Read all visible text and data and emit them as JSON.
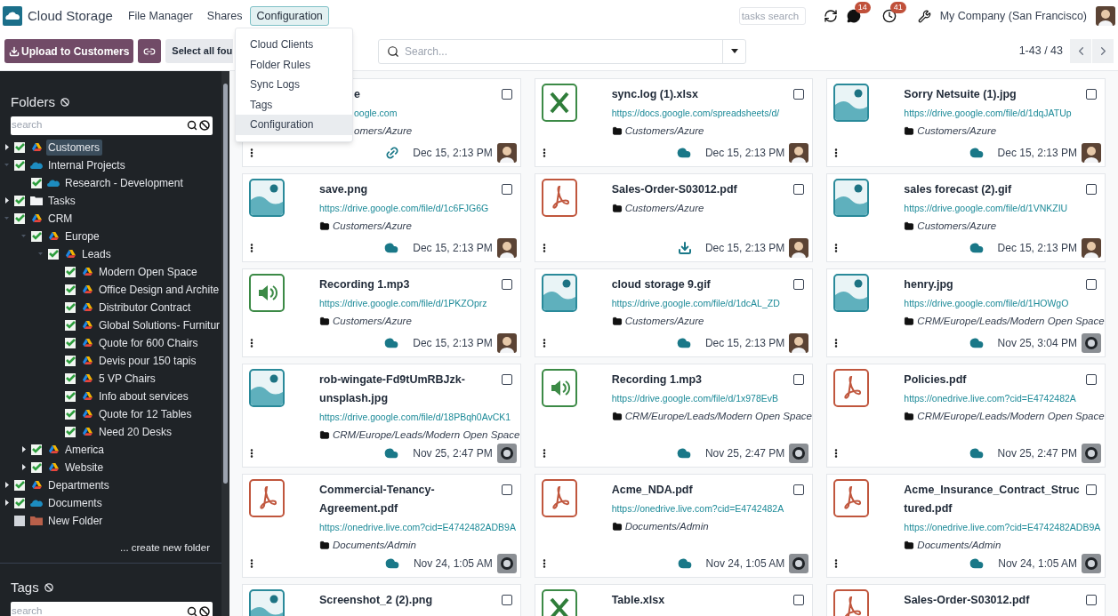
{
  "app": {
    "name": "Cloud Storage"
  },
  "nav": [
    {
      "label": "File Manager",
      "selected": false
    },
    {
      "label": "Shares",
      "selected": false
    },
    {
      "label": "Configuration",
      "selected": true
    }
  ],
  "menu": [
    {
      "label": "Cloud Clients",
      "selected": false
    },
    {
      "label": "Folder Rules",
      "selected": false
    },
    {
      "label": "Sync Logs",
      "selected": false
    },
    {
      "label": "Tags",
      "selected": false
    },
    {
      "label": "Configuration",
      "selected": true
    }
  ],
  "systray": {
    "tasks_search": {
      "placeholder": "tasks search"
    },
    "messages_badge": "14",
    "activities_badge": "41",
    "company": "My Company (San Francisco)"
  },
  "toolbar": {
    "upload_button": "Upload to Customers",
    "select_all_button": "Select all fou",
    "search": {
      "placeholder": "Search..."
    },
    "pager": "1-43 / 43"
  },
  "folders": {
    "title": "Folders",
    "search": {
      "placeholder": "search"
    },
    "create_link": "... create new folder",
    "tree": [
      {
        "label": "Customers",
        "kind": "drive",
        "checked": true,
        "selected": true,
        "expanded": false
      },
      {
        "label": "Internal Projects",
        "kind": "cloud",
        "checked": true,
        "selected": false,
        "expanded": true,
        "children": [
          {
            "label": "Research - Development",
            "kind": "cloud",
            "checked": true,
            "selected": false
          }
        ]
      },
      {
        "label": "Tasks",
        "kind": "folder",
        "checked": true,
        "selected": false,
        "expanded": false
      },
      {
        "label": "CRM",
        "kind": "drive",
        "checked": true,
        "selected": false,
        "expanded": true,
        "children": [
          {
            "label": "Europe",
            "kind": "drive",
            "checked": true,
            "selected": false,
            "expanded": true,
            "children": [
              {
                "label": "Leads",
                "kind": "drive",
                "checked": true,
                "selected": false,
                "expanded": true,
                "children": [
                  {
                    "label": "Modern Open Space",
                    "kind": "drive",
                    "checked": true,
                    "selected": false
                  },
                  {
                    "label": "Office Design and Archite",
                    "kind": "drive",
                    "checked": true,
                    "selected": false
                  },
                  {
                    "label": "Distributor Contract",
                    "kind": "drive",
                    "checked": true,
                    "selected": false
                  },
                  {
                    "label": "Global Solutions- Furnitur",
                    "kind": "drive",
                    "checked": true,
                    "selected": false
                  },
                  {
                    "label": "Quote for 600 Chairs",
                    "kind": "drive",
                    "checked": true,
                    "selected": false
                  },
                  {
                    "label": "Devis pour 150 tapis",
                    "kind": "drive",
                    "checked": true,
                    "selected": false
                  },
                  {
                    "label": "5 VP Chairs",
                    "kind": "drive",
                    "checked": true,
                    "selected": false
                  },
                  {
                    "label": "Info about services",
                    "kind": "drive",
                    "checked": true,
                    "selected": false
                  },
                  {
                    "label": "Quote for 12 Tables",
                    "kind": "drive",
                    "checked": true,
                    "selected": false
                  },
                  {
                    "label": "Need 20 Desks",
                    "kind": "drive",
                    "checked": true,
                    "selected": false
                  }
                ]
              }
            ]
          },
          {
            "label": "America",
            "kind": "drive",
            "checked": true,
            "selected": false,
            "expanded": false
          },
          {
            "label": "Website",
            "kind": "drive",
            "checked": true,
            "selected": false,
            "expanded": false
          }
        ]
      },
      {
        "label": "Departments",
        "kind": "drive",
        "checked": true,
        "selected": false,
        "expanded": false
      },
      {
        "label": "Documents",
        "kind": "cloud",
        "checked": true,
        "selected": false,
        "expanded": false
      },
      {
        "label": "New Folder",
        "kind": "local",
        "checked": false,
        "selected": false
      }
    ]
  },
  "tags": {
    "title": "Tags",
    "search": {
      "placeholder": "search"
    }
  },
  "files": [
    {
      "title": "e",
      "url": "oogle.com",
      "folder": "omers/Azure",
      "covered": true,
      "sync": {
        "kind": "link"
      },
      "date": "Dec 15, 2:13 PM",
      "owner": {
        "kind": "person"
      },
      "checked": false
    },
    {
      "title": "sync.log (1).xlsx",
      "url": "https://docs.google.com/spreadsheets/d/",
      "folder": "Customers/Azure",
      "thumbnail": {
        "kind": "xlsx"
      },
      "sync": {
        "kind": "cloud"
      },
      "date": "Dec 15, 2:13 PM",
      "owner": {
        "kind": "person"
      },
      "checked": false
    },
    {
      "title": "Sorry Netsuite (1).jpg",
      "url": "https://drive.google.com/file/d/1dqJATUp",
      "folder": "Customers/Azure",
      "thumbnail": {
        "kind": "image"
      },
      "sync": {
        "kind": "cloud"
      },
      "date": "Dec 15, 2:13 PM",
      "owner": {
        "kind": "person"
      },
      "checked": false
    },
    {
      "title": "save.png",
      "url": "https://drive.google.com/file/d/1c6FJG6G",
      "folder": "Customers/Azure",
      "thumbnail": {
        "kind": "image"
      },
      "sync": {
        "kind": "cloud"
      },
      "date": "Dec 15, 2:13 PM",
      "owner": {
        "kind": "person"
      },
      "checked": false
    },
    {
      "title": "Sales-Order-S03012.pdf",
      "folder": "Customers/Azure",
      "thumbnail": {
        "kind": "pdf"
      },
      "sync": {
        "kind": "download"
      },
      "date": "Dec 15, 2:13 PM",
      "owner": {
        "kind": "person"
      },
      "checked": false
    },
    {
      "title": "sales forecast (2).gif",
      "url": "https://drive.google.com/file/d/1VNKZIU",
      "folder": "Customers/Azure",
      "thumbnail": {
        "kind": "image"
      },
      "sync": {
        "kind": "cloud"
      },
      "date": "Dec 15, 2:13 PM",
      "owner": {
        "kind": "person"
      },
      "checked": false
    },
    {
      "title": "Recording 1.mp3",
      "url": "https://drive.google.com/file/d/1PKZOprz",
      "folder": "Customers/Azure",
      "thumbnail": {
        "kind": "audio"
      },
      "sync": {
        "kind": "cloud"
      },
      "date": "Dec 15, 2:13 PM",
      "owner": {
        "kind": "person"
      },
      "checked": false
    },
    {
      "title": "cloud storage 9.gif",
      "url": "https://drive.google.com/file/d/1dcAL_ZD",
      "folder": "Customers/Azure",
      "thumbnail": {
        "kind": "image"
      },
      "sync": {
        "kind": "cloud"
      },
      "date": "Dec 15, 2:13 PM",
      "owner": {
        "kind": "person"
      },
      "checked": false
    },
    {
      "title": "henry.jpg",
      "url": "https://drive.google.com/file/d/1HOWgO",
      "folder": "CRM/Europe/Leads/Modern Open Space",
      "thumbnail": {
        "kind": "image"
      },
      "sync": {
        "kind": "cloud"
      },
      "date": "Nov 25, 3:04 PM",
      "owner": {
        "kind": "bot"
      },
      "checked": false
    },
    {
      "title": "rob-wingate-Fd9tUmRBJzk-unsplash.jpg",
      "url": "https://drive.google.com/file/d/18PBqh0AvCK1",
      "folder": "CRM/Europe/Leads/Modern Open Space",
      "thumbnail": {
        "kind": "image"
      },
      "sync": {
        "kind": "cloud"
      },
      "date": "Nov 25, 2:47 PM",
      "owner": {
        "kind": "bot"
      },
      "checked": false
    },
    {
      "title": "Recording 1.mp3",
      "url": "https://drive.google.com/file/d/1x978EvB",
      "folder": "CRM/Europe/Leads/Modern Open Space",
      "thumbnail": {
        "kind": "audio"
      },
      "sync": {
        "kind": "cloud"
      },
      "date": "Nov 25, 2:47 PM",
      "owner": {
        "kind": "bot"
      },
      "checked": false
    },
    {
      "title": "Policies.pdf",
      "url": "https://onedrive.live.com?cid=E4742482A",
      "folder": "CRM/Europe/Leads/Modern Open Space",
      "thumbnail": {
        "kind": "pdf"
      },
      "sync": {
        "kind": "cloud"
      },
      "date": "Nov 25, 2:47 PM",
      "owner": {
        "kind": "bot"
      },
      "checked": false
    },
    {
      "title": "Commercial-Tenancy-Agreement.pdf",
      "url": "https://onedrive.live.com?cid=E4742482ADB9A",
      "folder": "Documents/Admin",
      "thumbnail": {
        "kind": "pdf"
      },
      "sync": {
        "kind": "cloud"
      },
      "date": "Nov 24, 1:05 AM",
      "owner": {
        "kind": "bot"
      },
      "checked": false
    },
    {
      "title": "Acme_NDA.pdf",
      "url": "https://onedrive.live.com?cid=E4742482A",
      "folder": "Documents/Admin",
      "thumbnail": {
        "kind": "pdf"
      },
      "sync": {
        "kind": "cloud"
      },
      "date": "Nov 24, 1:05 AM",
      "owner": {
        "kind": "bot"
      },
      "checked": false
    },
    {
      "title": "Acme_Insurance_Contract_Structured.pdf",
      "url": "https://onedrive.live.com?cid=E4742482ADB9A",
      "folder": "Documents/Admin",
      "thumbnail": {
        "kind": "pdf"
      },
      "sync": {
        "kind": "cloud"
      },
      "date": "Nov 24, 1:05 AM",
      "owner": {
        "kind": "bot"
      },
      "checked": false
    },
    {
      "title": "Screenshot_2 (2).png",
      "thumbnail": {
        "kind": "image"
      },
      "checked": false
    },
    {
      "title": "Table.xlsx",
      "thumbnail": {
        "kind": "xlsx"
      },
      "checked": false
    },
    {
      "title": "Sales-Order-S03012.pdf",
      "thumbnail": {
        "kind": "pdf"
      },
      "checked": false
    }
  ]
}
